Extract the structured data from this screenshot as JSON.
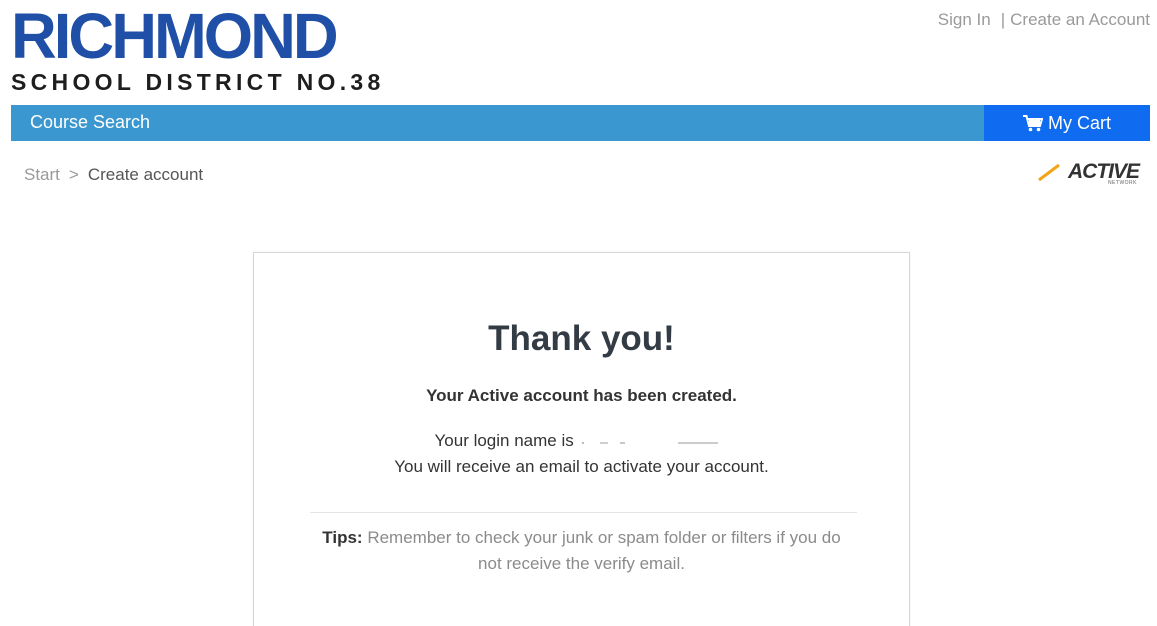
{
  "logo": {
    "main": "RICHMOND",
    "sub": "SCHOOL DISTRICT NO.38"
  },
  "top_links": {
    "sign_in": "Sign In",
    "separator": "|",
    "create_account": "Create an Account"
  },
  "nav": {
    "course_search": "Course Search",
    "cart": "My Cart",
    "cart_icon": "cart-icon",
    "bar_color": "#3b97d0",
    "cart_color": "#0f6bf0"
  },
  "breadcrumb": {
    "start": "Start",
    "separator": ">",
    "current": "Create account"
  },
  "brand": {
    "active": "ACTIVE",
    "active_sub": "NETWORK"
  },
  "confirmation": {
    "title": "Thank you!",
    "created": "Your Active account has been created.",
    "login_prefix": "Your login name is",
    "activate": "You will receive an email to activate your account.",
    "tips_label": "Tips:",
    "tips_text": "Remember to check your junk or spam folder or filters if you do not receive the verify email."
  }
}
